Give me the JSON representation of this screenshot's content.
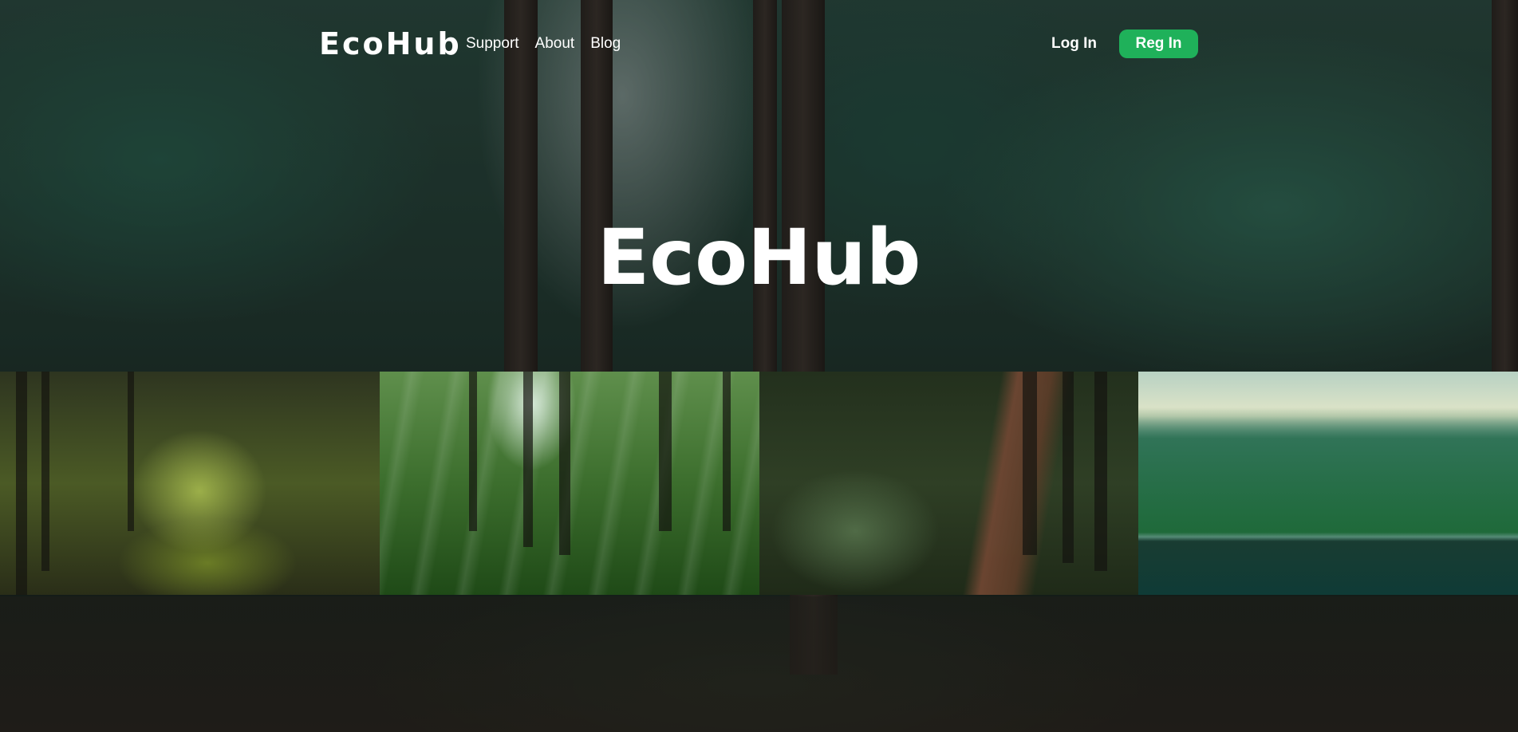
{
  "header": {
    "brand": "EcoHub",
    "nav": [
      {
        "label": "Support"
      },
      {
        "label": "About"
      },
      {
        "label": "Blog"
      }
    ],
    "login_label": "Log In",
    "register_label": "Reg In"
  },
  "hero": {
    "title": "EcoHub"
  },
  "gallery": {
    "images": [
      {
        "name": "mossy-forest-image"
      },
      {
        "name": "sunbeam-forest-image"
      },
      {
        "name": "forest-path-image"
      },
      {
        "name": "mountain-lake-image"
      }
    ]
  },
  "colors": {
    "accent": "#1fb15a",
    "text": "#ffffff"
  }
}
